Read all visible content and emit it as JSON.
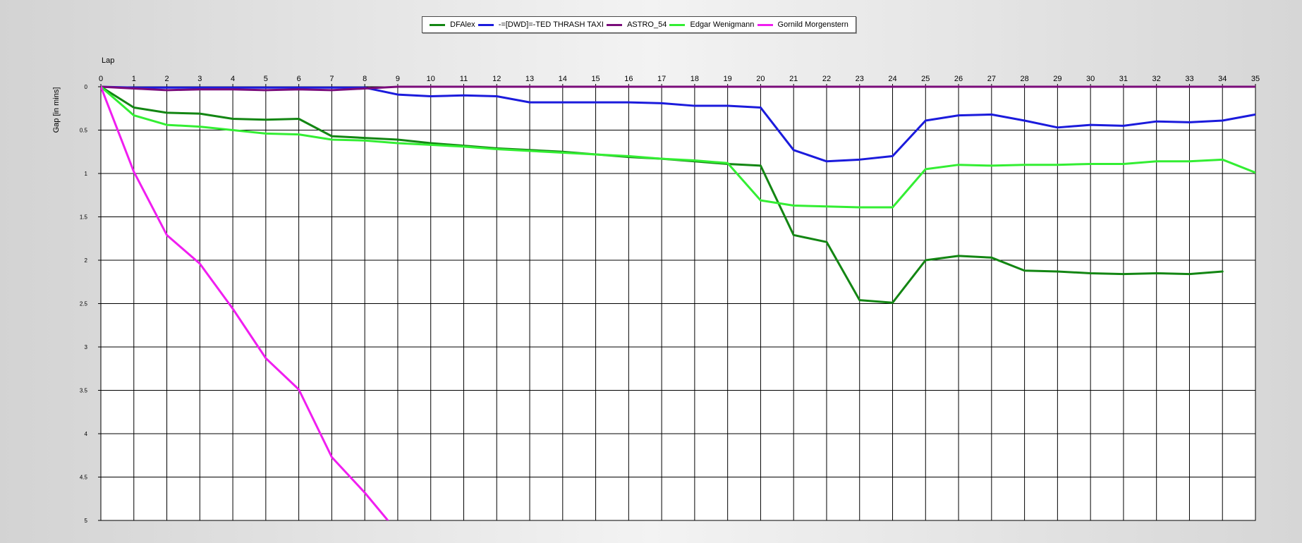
{
  "chart_data": {
    "type": "line",
    "title": "",
    "xlabel": "Lap",
    "ylabel": "Gap [in mins]",
    "xlim": [
      0,
      35
    ],
    "ylim": [
      0,
      5
    ],
    "y_inverted": true,
    "grid": true,
    "legend_position": "top-center",
    "x_ticks": [
      "0",
      "1",
      "2",
      "3",
      "4",
      "5",
      "6",
      "7",
      "8",
      "9",
      "10",
      "11",
      "12",
      "13",
      "14",
      "15",
      "16",
      "17",
      "18",
      "19",
      "20",
      "21",
      "22",
      "23",
      "24",
      "25",
      "26",
      "27",
      "28",
      "29",
      "30",
      "31",
      "32",
      "33",
      "34",
      "35"
    ],
    "y_ticks": [
      "0",
      "0.5",
      "1",
      "1.5",
      "2",
      "2.5",
      "3",
      "3.5",
      "4",
      "4.5",
      "5"
    ],
    "series": [
      {
        "name": "DFAlex",
        "color": "#138613",
        "x": [
          0,
          1,
          2,
          3,
          4,
          5,
          6,
          7,
          8,
          9,
          10,
          11,
          12,
          13,
          14,
          15,
          16,
          17,
          18,
          19,
          20,
          21,
          22,
          23,
          24,
          25,
          26,
          27,
          28,
          29,
          30,
          31,
          32,
          33,
          34
        ],
        "values": [
          0,
          0.24,
          0.3,
          0.31,
          0.37,
          0.38,
          0.37,
          0.57,
          0.59,
          0.61,
          0.65,
          0.68,
          0.71,
          0.73,
          0.75,
          0.78,
          0.81,
          0.83,
          0.86,
          0.89,
          0.91,
          1.71,
          1.79,
          2.46,
          2.49,
          2.0,
          1.95,
          1.97,
          2.12,
          2.13,
          2.15,
          2.16,
          2.15,
          2.16,
          2.13
        ]
      },
      {
        "name": "-=[DWD]=-TED THRASH TAXI",
        "color": "#1b1bdc",
        "x": [
          0,
          1,
          2,
          3,
          4,
          5,
          6,
          7,
          8,
          9,
          10,
          11,
          12,
          13,
          14,
          15,
          16,
          17,
          18,
          19,
          20,
          21,
          22,
          23,
          24,
          25,
          26,
          27,
          28,
          29,
          30,
          31,
          32,
          33,
          34,
          35
        ],
        "values": [
          0,
          0.01,
          0.01,
          0.01,
          0.01,
          0.01,
          0.01,
          0.01,
          0.01,
          0.09,
          0.11,
          0.1,
          0.11,
          0.18,
          0.18,
          0.18,
          0.18,
          0.19,
          0.22,
          0.22,
          0.24,
          0.73,
          0.86,
          0.84,
          0.8,
          0.39,
          0.33,
          0.32,
          0.39,
          0.47,
          0.44,
          0.45,
          0.4,
          0.41,
          0.39,
          0.32
        ]
      },
      {
        "name": "ASTRO_54",
        "color": "#7a0c7a",
        "x": [
          0,
          1,
          2,
          3,
          4,
          5,
          6,
          7,
          8,
          9,
          10,
          11,
          12,
          13,
          14,
          15,
          16,
          17,
          18,
          19,
          20,
          21,
          22,
          23,
          24,
          25,
          26,
          27,
          28,
          29,
          30,
          31,
          32,
          33,
          34,
          35
        ],
        "values": [
          0,
          0.02,
          0.04,
          0.03,
          0.03,
          0.04,
          0.03,
          0.04,
          0.02,
          0,
          0,
          0,
          0,
          0,
          0,
          0,
          0,
          0,
          0,
          0,
          0,
          0,
          0,
          0,
          0,
          0,
          0,
          0,
          0,
          0,
          0,
          0,
          0,
          0,
          0,
          0
        ]
      },
      {
        "name": "Edgar Wenigmann",
        "color": "#33ee33",
        "x": [
          0,
          1,
          2,
          3,
          4,
          5,
          6,
          7,
          8,
          9,
          10,
          11,
          12,
          13,
          14,
          15,
          16,
          17,
          18,
          19,
          20,
          21,
          22,
          23,
          24,
          25,
          26,
          27,
          28,
          29,
          30,
          31,
          32,
          33,
          34,
          35
        ],
        "values": [
          0,
          0.33,
          0.44,
          0.46,
          0.5,
          0.54,
          0.55,
          0.61,
          0.62,
          0.65,
          0.67,
          0.69,
          0.72,
          0.74,
          0.76,
          0.78,
          0.8,
          0.83,
          0.85,
          0.88,
          1.31,
          1.37,
          1.38,
          1.39,
          1.39,
          0.95,
          0.9,
          0.91,
          0.9,
          0.9,
          0.89,
          0.89,
          0.86,
          0.86,
          0.84,
          0.99
        ]
      },
      {
        "name": "Gornild Morgenstern",
        "color": "#f01ef0",
        "x": [
          0,
          1,
          2,
          3,
          4,
          5,
          6,
          7,
          8,
          8.7
        ],
        "values": [
          0,
          0.98,
          1.71,
          2.04,
          2.56,
          3.13,
          3.49,
          4.27,
          4.68,
          5.0
        ]
      }
    ]
  }
}
